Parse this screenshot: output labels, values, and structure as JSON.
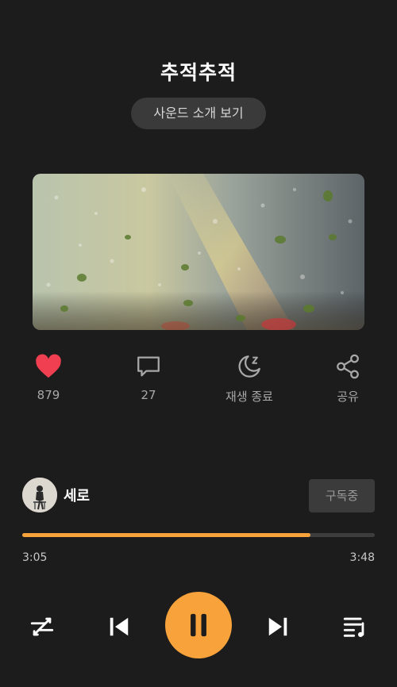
{
  "header": {
    "title": "추적추적",
    "intro_button": "사운드 소개 보기"
  },
  "artwork": {
    "description_icon": "rain-window-image"
  },
  "actions": [
    {
      "icon": "heart-icon",
      "label": "879"
    },
    {
      "icon": "comment-icon",
      "label": "27"
    },
    {
      "icon": "moon-sleep-icon",
      "label": "재생 종료"
    },
    {
      "icon": "share-icon",
      "label": "공유"
    }
  ],
  "creator": {
    "name": "세로",
    "subscribe_label": "구독중"
  },
  "player": {
    "current_time": "3:05",
    "total_time": "3:48",
    "progress": 0.818,
    "accent_color": "#f7a23b"
  }
}
